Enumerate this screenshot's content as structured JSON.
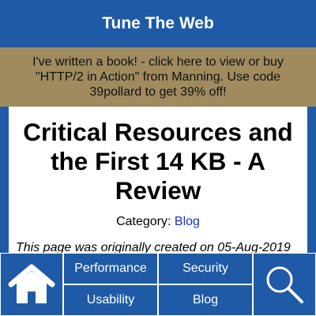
{
  "header": {
    "title": "Tune The Web"
  },
  "promo": {
    "text": "I've written a book! - click here to view or buy \"HTTP/2 in Action\" from Manning. Use code 39pollard to get 39% off!"
  },
  "article": {
    "title": "Critical Resources and the First 14 KB - A Review",
    "category_label": "Category:",
    "category_link": "Blog",
    "original_note": "This page was originally created on 05-Aug-2019"
  },
  "nav": {
    "home_icon": "home-icon",
    "search_icon": "search-icon",
    "items": [
      {
        "label": "Performance"
      },
      {
        "label": "Security"
      },
      {
        "label": "Usability"
      },
      {
        "label": "Blog"
      }
    ]
  },
  "colors": {
    "brand_blue": "#1f5aa6",
    "promo_bg": "#a08b5e",
    "link": "#1a2fd4"
  }
}
